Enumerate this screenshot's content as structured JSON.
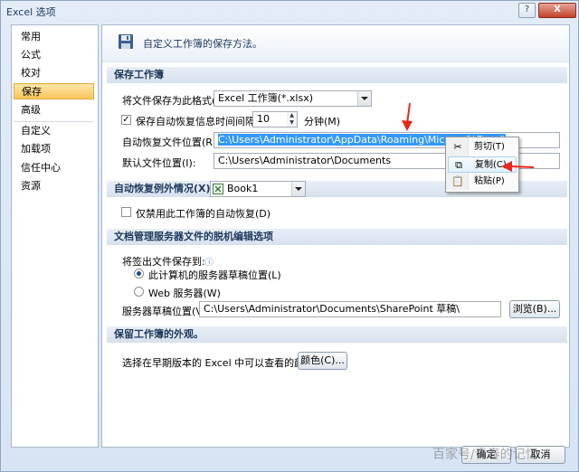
{
  "window": {
    "title": "Excel 选项",
    "help_glyph": "?",
    "close_glyph": "X"
  },
  "sidebar": {
    "items": [
      {
        "label": "常用"
      },
      {
        "label": "公式"
      },
      {
        "label": "校对"
      },
      {
        "label": "保存"
      },
      {
        "label": "高级"
      },
      {
        "label": "自定义"
      },
      {
        "label": "加载项"
      },
      {
        "label": "信任中心"
      },
      {
        "label": "资源"
      }
    ],
    "selected_index": 3
  },
  "hero": {
    "text": "自定义工作簿的保存方法。"
  },
  "save_section": {
    "header": "保存工作簿",
    "format_label": "将文件保存为此格式(F):",
    "format_value": "Excel 工作簿(*.xlsx)",
    "autorecover_checkbox_label": "保存自动恢复信息时间间隔(A)",
    "autorecover_checked": true,
    "autorecover_minutes": "10",
    "minutes_label": "分钟(M)",
    "autorecover_path_label": "自动恢复文件位置(R):",
    "autorecover_path_value": "C:\\Users\\Administrator\\AppData\\Roaming\\Microsoft\\Excel\\",
    "default_path_label": "默认文件位置(I):",
    "default_path_value": "C:\\Users\\Administrator\\Documents"
  },
  "exception_section": {
    "header": "自动恢复例外情况(X):",
    "workbook_value": "Book1",
    "disable_checkbox_label": "仅禁用此工作簿的自动恢复(D)",
    "disable_checked": false
  },
  "offline_section": {
    "header": "文档管理服务器文件的脱机编辑选项",
    "saveto_label": "将签出文件保存到:",
    "radio_local_label": "此计算机的服务器草稿位置(L)",
    "radio_web_label": "Web 服务器(W)",
    "selected_radio": "local",
    "drafts_label": "服务器草稿位置(V):",
    "drafts_value": "C:\\Users\\Administrator\\Documents\\SharePoint 草稿\\",
    "browse_button": "浏览(B)..."
  },
  "appearance_section": {
    "header": "保留工作簿的外观。",
    "colors_label": "选择在早期版本的 Excel 中可以查看的颜色:",
    "colors_button": "颜色(C)..."
  },
  "context_menu": {
    "items": [
      {
        "label": "剪切(T)",
        "icon": "scissors-icon"
      },
      {
        "label": "复制(C)",
        "icon": "copy-icon"
      },
      {
        "label": "粘贴(P)",
        "icon": "paste-icon"
      }
    ],
    "highlighted_index": 1
  },
  "footer": {
    "ok_button": "确定",
    "cancel_button": "取消"
  },
  "watermark": "百家号/青春的记忆",
  "colors": {
    "accent_red": "#e8271c",
    "selection": "#3399ff",
    "sidebar_selected": "#f8c55e"
  }
}
